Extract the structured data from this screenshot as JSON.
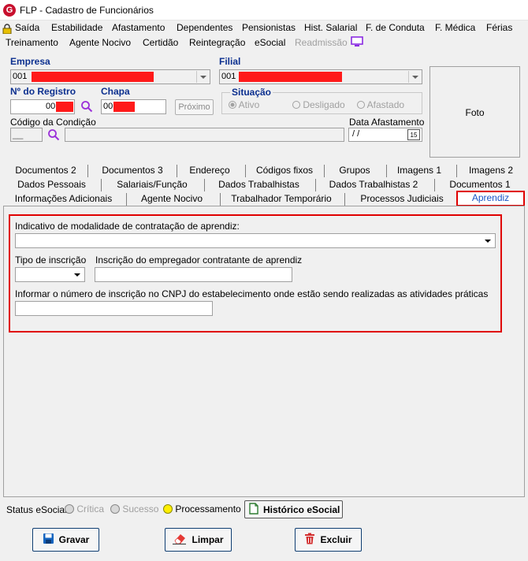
{
  "window": {
    "title": "FLP - Cadastro de Funcionários",
    "logo": "G"
  },
  "menu": {
    "row1": [
      "Saída",
      "Estabilidade",
      "Afastamento",
      "Dependentes",
      "Pensionistas",
      "Hist. Salarial",
      "F. de Conduta",
      "F. Médica",
      "Férias"
    ],
    "row2": [
      "Treinamento",
      "Agente Nocivo",
      "Certidão",
      "Reintegração",
      "eSocial",
      "Readmissão"
    ]
  },
  "header": {
    "empresa_label": "Empresa",
    "empresa_value": "001",
    "filial_label": "Filial",
    "filial_value": "001",
    "registro_label": "Nº do Registro",
    "registro_value": "00",
    "chapa_label": "Chapa",
    "chapa_value": "00",
    "proximo_label": "Próximo",
    "situacao_label": "Situação",
    "situacao_options": [
      "Ativo",
      "Desligado",
      "Afastado"
    ],
    "codigo_label": "Código da Condição",
    "codigo_value": "__",
    "data_label": "Data Afastamento",
    "data_value": " / /",
    "calendar_day": "15",
    "foto_label": "Foto"
  },
  "tabs": {
    "row1": [
      "Documentos 2",
      "Documentos 3",
      "Endereço",
      "Códigos fixos",
      "Grupos",
      "Imagens 1",
      "Imagens 2"
    ],
    "row2": [
      "Dados Pessoais",
      "Salariais/Função",
      "Dados Trabalhistas",
      "Dados Trabalhistas 2",
      "Documentos 1"
    ],
    "row3": [
      "Informações Adicionais",
      "Agente Nocivo",
      "Trabalhador Temporário",
      "Processos Judiciais",
      "Aprendiz"
    ]
  },
  "aprendiz": {
    "modalidade_label": "Indicativo de modalidade de contratação de aprendiz:",
    "modalidade_value": "",
    "tipo_label": "Tipo de inscrição",
    "tipo_value": "",
    "inscricao_label": "Inscrição do empregador contratante de aprendiz",
    "inscricao_value": "",
    "cnpj_label": "Informar o número de inscrição no CNPJ do estabelecimento onde estão sendo realizadas as atividades práticas",
    "cnpj_value": ""
  },
  "status": {
    "label": "Status eSocial:",
    "items": [
      "Crítica",
      "Sucesso",
      "Processamento"
    ],
    "historico_label": "Histórico eSocial"
  },
  "actions": {
    "gravar": "Gravar",
    "limpar": "Limpar",
    "excluir": "Excluir"
  },
  "colors": {
    "highlight": "#e00000",
    "label_blue": "#0b2f8f",
    "processamento": "#ffee00",
    "tab_active_text": "#1a56c8"
  }
}
